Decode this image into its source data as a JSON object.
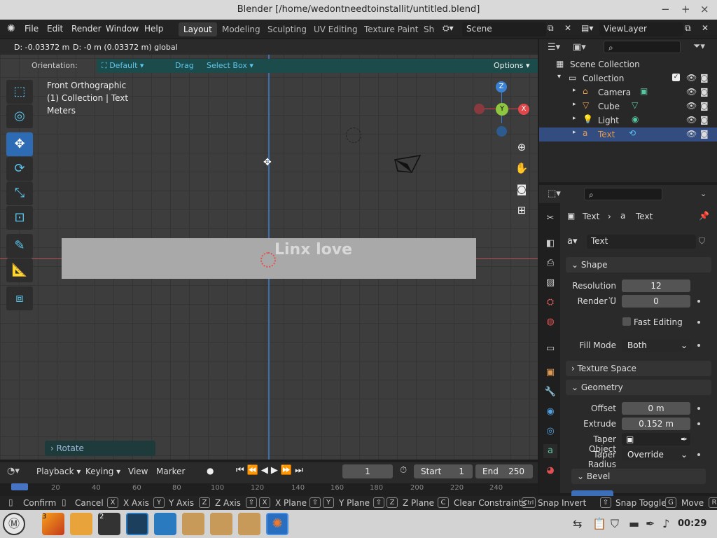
{
  "window": {
    "title": "Blender [/home/wedontneedtoinstallit/untitled.blend]",
    "minimize": "−",
    "maximize": "+",
    "close": "×"
  },
  "menu": {
    "file": "File",
    "edit": "Edit",
    "render": "Render",
    "window": "Window",
    "help": "Help"
  },
  "workspaces": [
    "Layout",
    "Modeling",
    "Sculpting",
    "UV Editing",
    "Texture Paint",
    "Sh"
  ],
  "scene": {
    "label": "Scene"
  },
  "view_layer": {
    "label": "ViewLayer"
  },
  "header_info": {
    "delta": "D: -0.03372 m",
    "delta_global": "D: -0 m (0.03372 m) global"
  },
  "tool_options": {
    "orientation_label": "Orientation:",
    "orientation_value": "Default",
    "drag": "Drag",
    "select": "Select Box",
    "options": "Options"
  },
  "viewport": {
    "view_name": "Front Orthographic",
    "collection": "(1) Collection | Text",
    "units": "Meters",
    "text_object": "Linx love",
    "last_op": "Rotate"
  },
  "gizmo": {
    "z": "Z",
    "y": "Y",
    "x": "X"
  },
  "outliner": {
    "scene_collection": "Scene Collection",
    "collection": "Collection",
    "items": [
      "Camera",
      "Cube",
      "Light",
      "Text"
    ]
  },
  "properties": {
    "breadcrumb_obj": "Text",
    "breadcrumb_data": "Text",
    "data_name": "Text",
    "shape_header": "Shape",
    "resolution_label": "Resolution ...",
    "resolution_value": "12",
    "render_u_label": "Render U",
    "render_u_value": "0",
    "fast_editing": "Fast Editing",
    "fill_mode_label": "Fill Mode",
    "fill_mode_value": "Both",
    "texture_space": "Texture Space",
    "geometry": "Geometry",
    "offset_label": "Offset",
    "offset_value": "0 m",
    "extrude_label": "Extrude",
    "extrude_value": "0.152 m",
    "taper_object_label": "Taper Object",
    "taper_radius_label": "Taper Radius",
    "taper_radius_value": "Override",
    "bevel": "Bevel"
  },
  "timeline": {
    "playback": "Playback",
    "keying": "Keying",
    "view": "View",
    "marker": "Marker",
    "current_frame": "1",
    "start_label": "Start",
    "start": "1",
    "end_label": "End",
    "end": "250",
    "ruler": [
      "20",
      "40",
      "60",
      "80",
      "100",
      "120",
      "140",
      "160",
      "180",
      "200",
      "220",
      "240"
    ]
  },
  "statusbar": {
    "confirm": "Confirm",
    "cancel": "Cancel",
    "x_axis": "X Axis",
    "y_axis": "Y Axis",
    "z_axis": "Z Axis",
    "x_plane": "X Plane",
    "y_plane": "Y Plane",
    "z_plane": "Z Plane",
    "clear_constraints": "Clear Constraints",
    "snap_invert": "Snap Invert",
    "snap_toggle": "Snap Toggle",
    "move": "Move",
    "keys": {
      "x": "X",
      "y": "Y",
      "z": "Z",
      "c": "C",
      "ctrl": "Ctrl",
      "g": "G",
      "shift": "⇧",
      "r": "R"
    }
  },
  "taskbar": {
    "clock": "00:29",
    "badge_firefox": "3",
    "badge_terminal": "2"
  },
  "colors": {
    "accent": "#59c6ee",
    "selected_row": "#334d80",
    "axis_x": "#e0484c",
    "axis_y": "#8ec63f",
    "axis_z": "#3b82d6",
    "active_tool": "#2d6bb5"
  }
}
